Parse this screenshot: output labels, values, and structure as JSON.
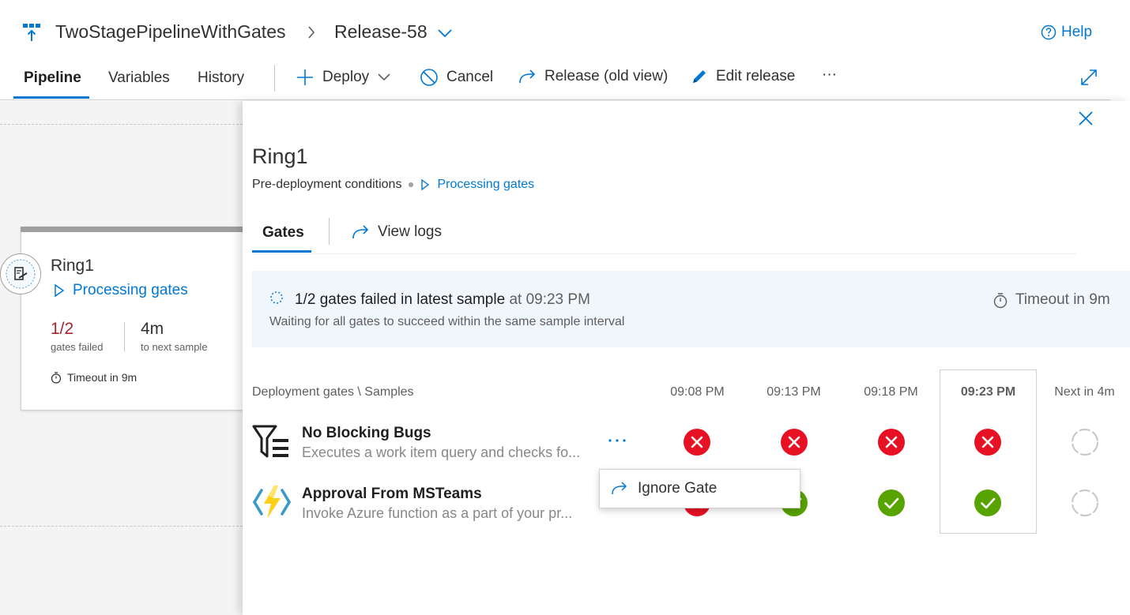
{
  "header": {
    "pipeline_name": "TwoStagePipelineWithGates",
    "release_name": "Release-58",
    "help_label": "Help"
  },
  "toolbar": {
    "tabs": [
      "Pipeline",
      "Variables",
      "History"
    ],
    "active_tab": "Pipeline",
    "deploy_label": "Deploy",
    "cancel_label": "Cancel",
    "old_view_label": "Release (old view)",
    "edit_label": "Edit release",
    "more_label": "···"
  },
  "stage_card": {
    "name": "Ring1",
    "status": "Processing gates",
    "failed_count": "1/2",
    "failed_label": "gates failed",
    "next_sample_value": "4m",
    "next_sample_label": "to next sample",
    "timeout": "Timeout in 9m"
  },
  "panel": {
    "title": "Ring1",
    "subtitle": "Pre-deployment conditions",
    "status": "Processing gates",
    "tabs": {
      "gates": "Gates",
      "view_logs": "View logs"
    },
    "banner": {
      "message": "1/2 gates failed in latest sample",
      "at_time": "at 09:23 PM",
      "detail": "Waiting for all gates to succeed within the same sample interval",
      "timeout": "Timeout in 9m"
    },
    "grid": {
      "header_label": "Deployment gates \\ Samples",
      "columns": [
        "09:08 PM",
        "09:13 PM",
        "09:18 PM",
        "09:23 PM",
        "Next in 4m"
      ],
      "current_column": "09:23 PM",
      "gates": [
        {
          "title": "No Blocking Bugs",
          "description": "Executes a work item query and checks fo...",
          "icon": "work-item-query-icon",
          "results": [
            "failed",
            "failed",
            "failed",
            "failed",
            "pending"
          ]
        },
        {
          "title": "Approval From MSTeams",
          "description": "Invoke Azure function as a part of your pr...",
          "icon": "azure-function-icon",
          "results": [
            "failed",
            "succeeded",
            "succeeded",
            "succeeded",
            "pending"
          ]
        }
      ]
    },
    "context_menu": {
      "ignore_gate": "Ignore Gate"
    }
  },
  "colors": {
    "accent": "#0078d4",
    "failed": "#e81123",
    "succeeded": "#57a300",
    "pending": "#c8c6c4",
    "banner_bg": "#eff6fc"
  }
}
